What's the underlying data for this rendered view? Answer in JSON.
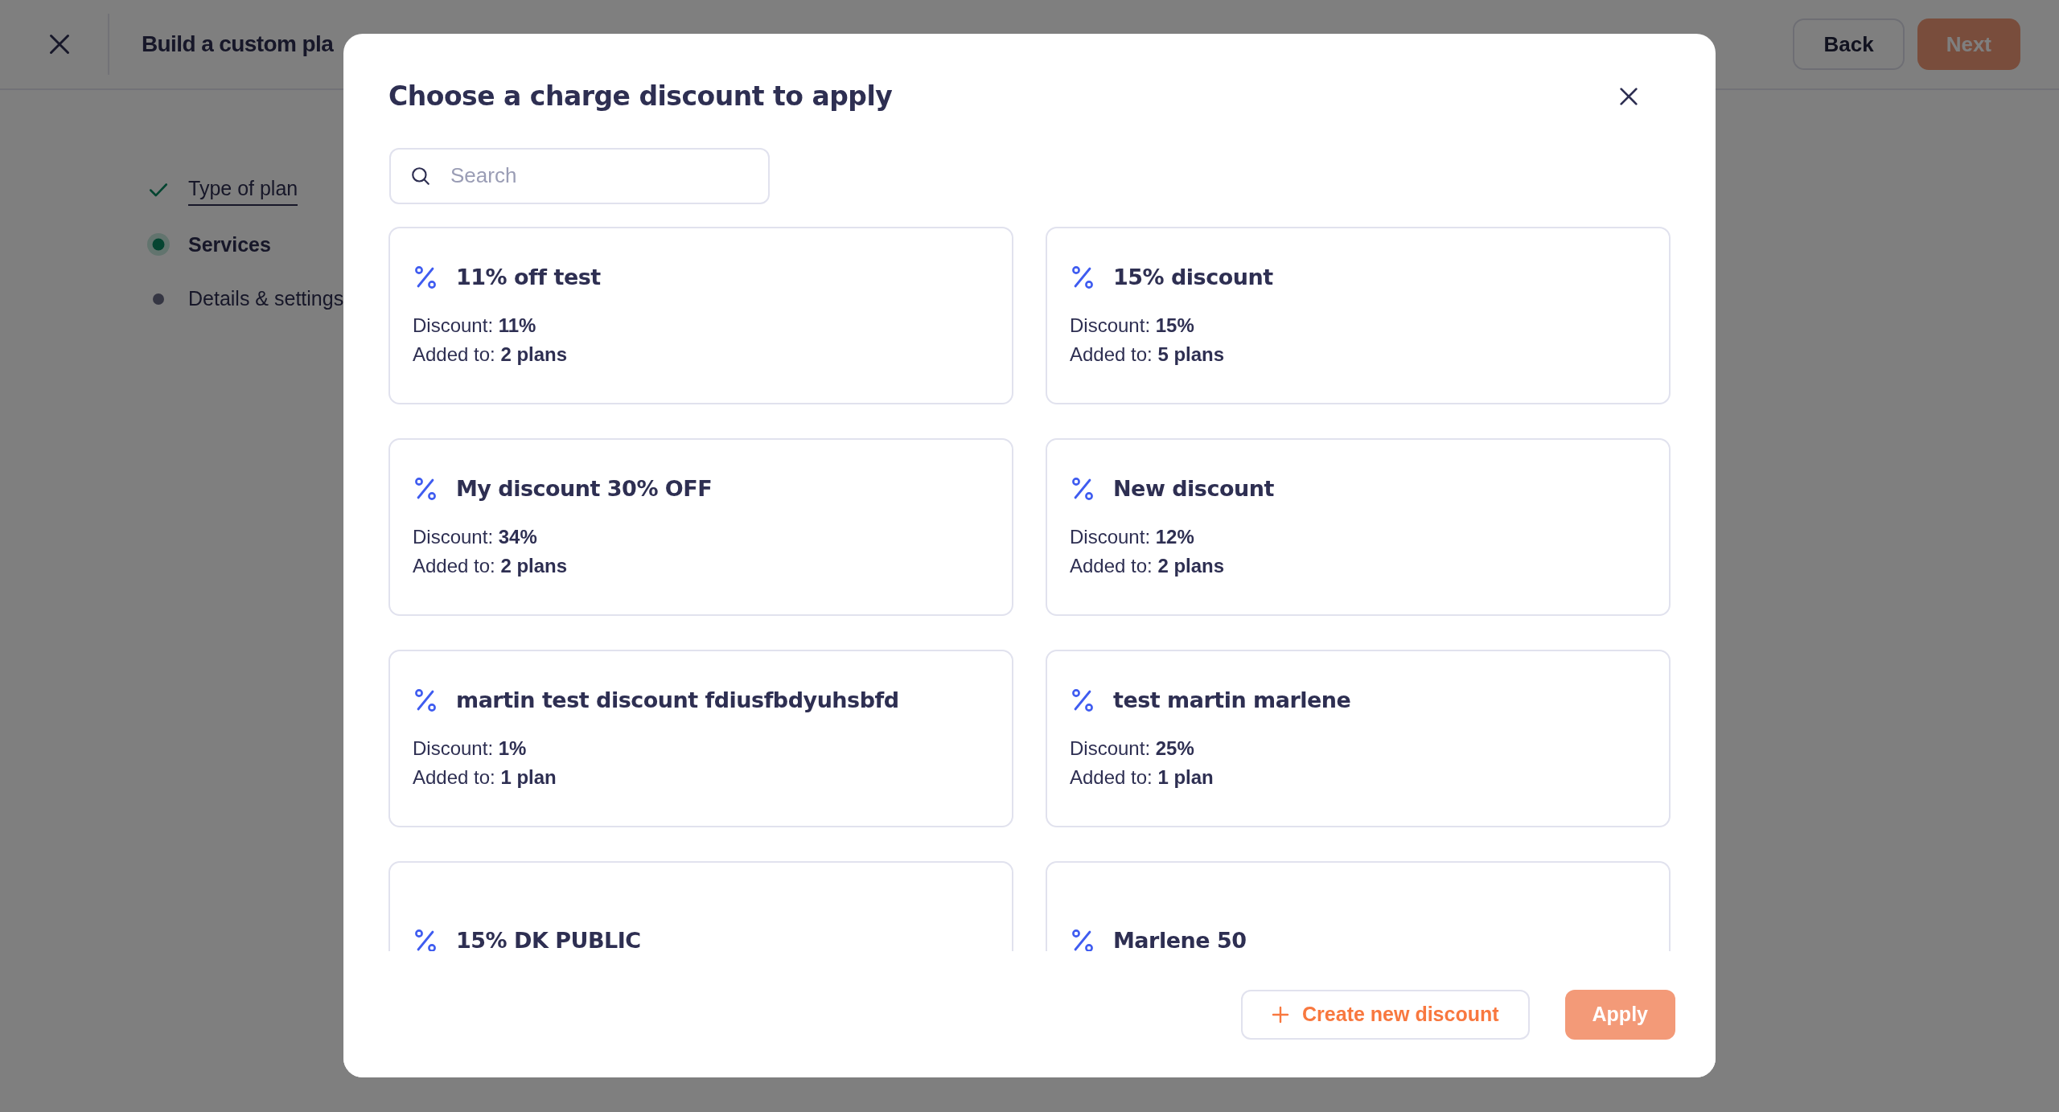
{
  "page": {
    "title": "Build a custom pla",
    "back_button": "Back",
    "next_button": {
      "label": "Next",
      "disabled": true
    }
  },
  "steps": [
    {
      "label": "Type of plan",
      "completed": true,
      "selected": false
    },
    {
      "label": "Services",
      "completed": false,
      "selected": true
    },
    {
      "label": "Details & settings",
      "completed": false,
      "selected": false
    }
  ],
  "modal": {
    "title": "Choose a charge discount to apply",
    "search": {
      "placeholder": "Search"
    },
    "discounts": [
      {
        "name": "11% off test",
        "selected": false,
        "details": [
          {
            "label": "Discount:",
            "value": "11%"
          },
          {
            "label": "Added to:",
            "value": "2 plans"
          }
        ]
      },
      {
        "name": "15% discount",
        "selected": false,
        "details": [
          {
            "label": "Discount:",
            "value": "15%"
          },
          {
            "label": "Added to:",
            "value": "5 plans"
          }
        ]
      },
      {
        "name": "My discount 30% OFF",
        "selected": false,
        "details": [
          {
            "label": "Discount:",
            "value": "34%"
          },
          {
            "label": "Added to:",
            "value": "2 plans"
          }
        ]
      },
      {
        "name": "New discount",
        "selected": false,
        "details": [
          {
            "label": "Discount:",
            "value": "12%"
          },
          {
            "label": "Added to:",
            "value": "2 plans"
          }
        ]
      },
      {
        "name": "martin test discount fdiusfbdyuhsbfd",
        "selected": false,
        "details": [
          {
            "label": "Discount:",
            "value": "1%"
          },
          {
            "label": "Added to:",
            "value": "1 plan"
          }
        ]
      },
      {
        "name": "test martin marlene",
        "selected": false,
        "details": [
          {
            "label": "Discount:",
            "value": "25%"
          },
          {
            "label": "Added to:",
            "value": "1 plan"
          }
        ]
      },
      {
        "name": "15% DK PUBLIC",
        "selected": false
      },
      {
        "name": "Marlene  50",
        "selected": false
      }
    ],
    "create_button": "Create new discount",
    "apply_button": {
      "label": "Apply",
      "disabled": true
    }
  }
}
